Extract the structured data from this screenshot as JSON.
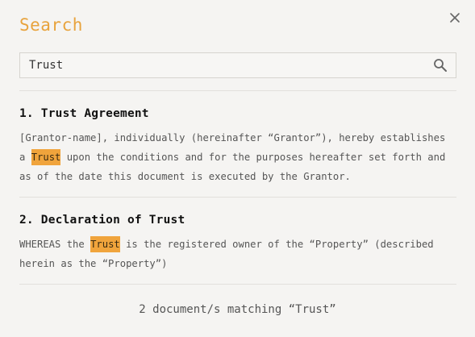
{
  "dialog": {
    "title": "Search",
    "close_label": "close"
  },
  "search": {
    "value": "Trust",
    "placeholder": ""
  },
  "results": [
    {
      "title": "1. Trust Agreement",
      "body_before": "[Grantor-name], individually (hereinafter “Grantor”), hereby establishes a ",
      "match": "Trust",
      "body_after": " upon the conditions and for the purposes hereafter set forth and as of the date this document is executed by the Grantor."
    },
    {
      "title": "2. Declaration of Trust",
      "body_before": "WHEREAS the ",
      "match": "Trust",
      "body_after": " is the registered owner of the “Property” (described herein as the “Property”)"
    }
  ],
  "footer": {
    "summary": "2 document/s matching “Trust”"
  },
  "colors": {
    "accent": "#e8a33d",
    "highlight": "#f0a43c"
  }
}
